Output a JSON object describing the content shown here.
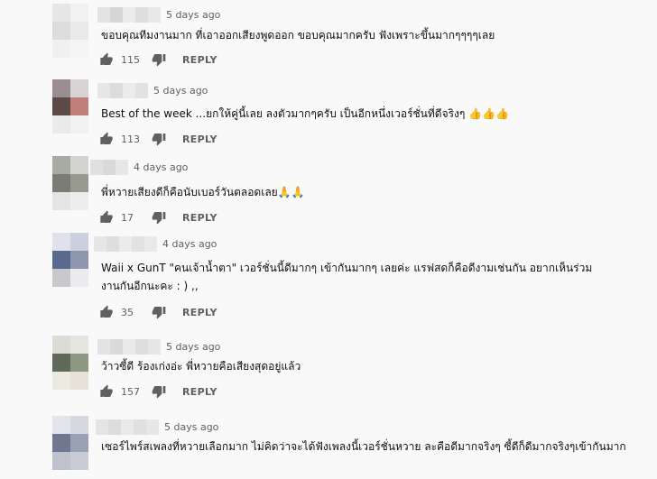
{
  "comments": [
    {
      "time": "5 days ago",
      "text": "ขอบคุณทีมงานมาก ที่เอาออกเสียงพูดออก ขอบคุณมากครับ ฟังเพราะขึ้นมากๆๆๆๆเลย",
      "likes": "115",
      "reply": "REPLY",
      "avatar_colors": [
        "#e6e6e6",
        "#f1f1f1",
        "#dcdcdc",
        "#e9e9e9",
        "#f0f0f0",
        "#f5f5f5"
      ],
      "author_colors": [
        "#e3e3e3",
        "#d6d6d6",
        "#ececec",
        "#dedede",
        "#e8e8e8"
      ],
      "emoji": ""
    },
    {
      "time": "5 days ago",
      "text": "Best of the week ...ยกให้คู่นี้เลย ลงตัวมากๆครับ เป็นอีกหนึ่งเวอร์ชั่นที่ดีจริงๆ",
      "likes": "113",
      "reply": "REPLY",
      "avatar_colors": [
        "#9b8e90",
        "#d8d3d3",
        "#5c4a47",
        "#c07f78",
        "#eaeaea",
        "#f2f2f2"
      ],
      "author_colors": [
        "#e6e6e6",
        "#dcdcdc",
        "#ececec",
        "#e2e2e2"
      ],
      "emoji": "👍👍👍"
    },
    {
      "time": "4 days ago",
      "text": "พี่หวายเสียงดีก็คือนับเบอร์วันตลอดเลย",
      "likes": "17",
      "reply": "REPLY",
      "avatar_colors": [
        "#a8aaa4",
        "#d3d4d0",
        "#7b7d74",
        "#98998f",
        "#e4e4e2",
        "#ededeb"
      ],
      "author_colors": [
        "#e0e0e0",
        "#d9d9d9",
        "#e7e7e7"
      ],
      "emoji": "🙏🙏"
    },
    {
      "time": "4 days ago",
      "text": "Waii x GunT \"คนเจ้าน้ำตา\" เวอร์ชั่นนี้ดีมากๆ เข้ากันมากๆ เลยค่ะ แรฟสดก็คือดีงามเช่นกัน อยากเห็นร่วมงานกันอีกนะคะ : ) ,,",
      "likes": "35",
      "reply": "REPLY",
      "avatar_colors": [
        "#dfe2ea",
        "#ccd0de",
        "#5a6a8f",
        "#8e97ae",
        "#c9c9cd",
        "#ececee"
      ],
      "author_colors": [
        "#e6e6e6",
        "#dedede",
        "#ebebeb",
        "#e2e2e2",
        "#e9e9e9"
      ],
      "emoji": ""
    },
    {
      "time": "5 days ago",
      "text": "ว้าวซี้ดี ร้องเก่งอ่ะ พี่หวายคือเสียงสุดอยู่แล้ว",
      "likes": "157",
      "reply": "REPLY",
      "avatar_colors": [
        "#dcdcd6",
        "#e5e5e0",
        "#5f6a58",
        "#8d9883",
        "#ece9e1",
        "#e6e2d7"
      ],
      "author_colors": [
        "#e3e3e3",
        "#dadada",
        "#e9e9e9",
        "#dedede",
        "#e6e6e6"
      ],
      "emoji": ""
    },
    {
      "time": "5 days ago",
      "text": "เซอร์ไพร์สเพลงที่หวายเลือกมาก ไม่คิดว่าจะได้ฟังเพลงนี้เวอร์ชั่นหวาย ละคือดีมากจริงๆ ซี้ดีก็ดีมากจริงๆเข้ากันมาก",
      "likes": "",
      "reply": "",
      "avatar_colors": [
        "#e2e4e9",
        "#d5d8df",
        "#6f7890",
        "#9aa1b3",
        "#bfc2cc",
        "#c9ccd4"
      ],
      "author_colors": [
        "#e4e4e4",
        "#dcdcdc",
        "#e9e9e9",
        "#e0e0e0",
        "#e7e7e7"
      ],
      "emoji": ""
    }
  ]
}
